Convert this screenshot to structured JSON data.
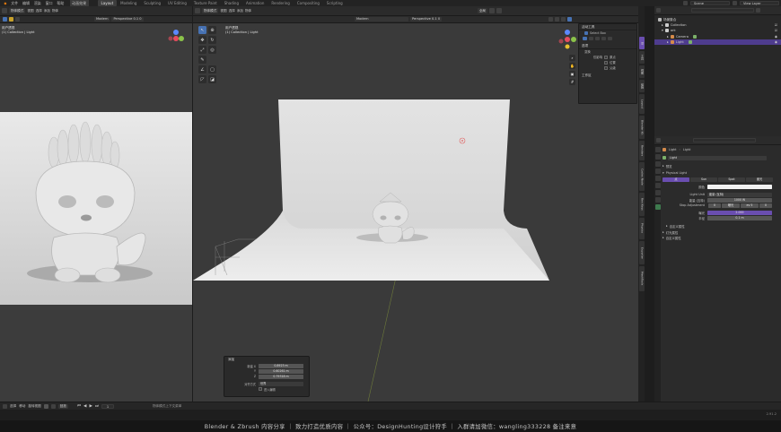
{
  "menu": [
    "文件",
    "编辑",
    "渲染",
    "窗口",
    "帮助"
  ],
  "extra_menu": "动画效果",
  "workspaces": [
    "Layout",
    "Modeling",
    "Sculpting",
    "UV Editing",
    "Texture Paint",
    "Shading",
    "Animation",
    "Rendering",
    "Compositing",
    "Scripting"
  ],
  "active_workspace": "Layout",
  "scene": {
    "label": "Scene",
    "value": "场景"
  },
  "view_layer": {
    "label": "View Layer",
    "value": "View Layer"
  },
  "left_viewport": {
    "mode": "物体模式",
    "menus": [
      "视图",
      "选择",
      "添加",
      "物体"
    ],
    "shading": "Modern",
    "snap": "Perspective 0.1 0",
    "view_title": "用户透视",
    "collection": "(1) Collection | Light"
  },
  "main_viewport": {
    "mode": "物体模式",
    "menus": [
      "视图",
      "选择",
      "添加",
      "物体"
    ],
    "global": "全局",
    "shading": "Modern",
    "snap": "Perspective 0.1 0",
    "view_title": "用户透视",
    "collection": "(1) Collection | Light"
  },
  "n_panel": {
    "tool_section": "活动工具",
    "select_box": "Select Box",
    "options_section": "选项",
    "transform_section": "变换",
    "affect_only": "仅影响",
    "origins": "原点",
    "locations": "位置",
    "parents": "父级",
    "workspace_section": "工作区"
  },
  "operator_panel": {
    "title": "添加",
    "rows": [
      {
        "label": "新建 X",
        "value": "0.8923 m"
      },
      {
        "label": "Y",
        "value": "0.60261 m"
      },
      {
        "label": "Z",
        "value": "0.79318 m"
      }
    ],
    "align_label": "对齐方式",
    "align_value": "世界",
    "check_label": "进入编辑"
  },
  "side_tabs": [
    "项",
    "工具",
    "视图",
    "编辑",
    "Layout",
    "Blender Kit",
    "Renders",
    "Cycles Node",
    "Ren Keys",
    "Physics",
    "Exporter",
    "MeshTools"
  ],
  "outliner": {
    "search": "",
    "rows": [
      {
        "name": "场景集合",
        "indent": 0,
        "color": "#bbbbbb"
      },
      {
        "name": "Collection",
        "indent": 4,
        "color": "#cccccc"
      },
      {
        "name": "ark",
        "indent": 4,
        "color": "#cccccc"
      },
      {
        "name": "Camera",
        "indent": 8,
        "color": "#d58a4a"
      },
      {
        "name": "Light",
        "indent": 8,
        "color": "#d58a4a"
      }
    ]
  },
  "properties": {
    "object_label": "Light",
    "data_label": "Light",
    "light_name": "Light",
    "preview_section": "预览",
    "physical_section": "Physical Light",
    "light_types": [
      "点",
      "Sun",
      "Spot",
      "面光"
    ],
    "color_label": "颜色",
    "unit_label": "Light Unit",
    "unit_value": "能量 (瓦特)",
    "power_label": "能量 (瓦特)",
    "power_value": "1000 W",
    "step_label": "Stop Adjustment",
    "step_values": [
      "0",
      "曝光",
      "ev 5",
      "0"
    ],
    "exposure_label": "曝光",
    "exposure_value": "2.000",
    "radius_label": "半径",
    "radius_value": "0.1 m",
    "custom_section": "自定义属性",
    "light_attr_section": "灯光属性",
    "extra_section": "自定义属性"
  },
  "statusbar": {
    "items": [
      "选择",
      "移动",
      "旋转视图",
      "物体模式上下文菜单"
    ],
    "frame_label": "回放",
    "frame": "1",
    "version": "2.91.2"
  },
  "watermark": "Blender & Zbrush 内容分享 ｜ 致力打造优质内容 ｜ 公众号：DesignHunting设计狩手 ｜ 入群请加微信：wangling333228 备注来意"
}
